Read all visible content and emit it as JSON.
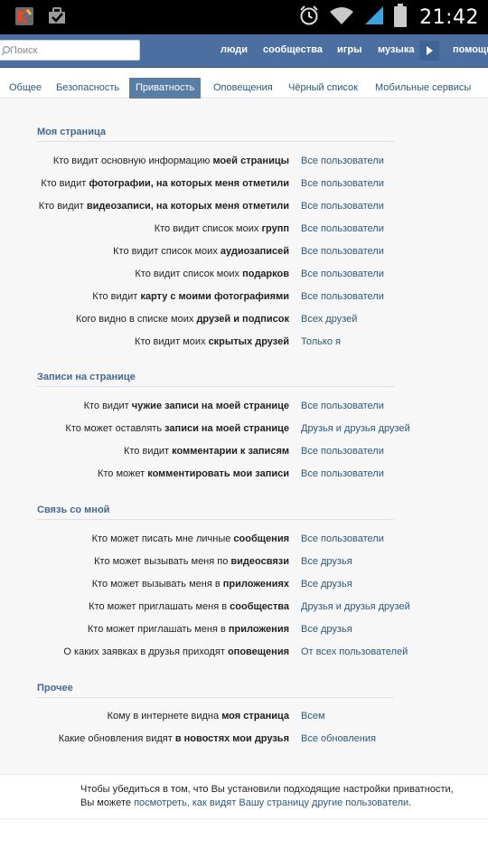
{
  "status_bar": {
    "time": "21:42",
    "icons": [
      "app-notification-icon",
      "briefcase-check-icon",
      "alarm-clock-icon",
      "wifi-icon",
      "signal-icon",
      "battery-icon"
    ]
  },
  "header": {
    "search": {
      "placeholder": "Поиск",
      "value": ""
    },
    "nav": [
      "люди",
      "сообщества",
      "игры",
      "музыка",
      "помощь"
    ],
    "more_icon": "play-arrow-icon",
    "colors": {
      "bar": "#4a6fa0",
      "link": "#2b587a",
      "section_title": "#45688e"
    }
  },
  "tabs": [
    {
      "label": "Общее",
      "active": false
    },
    {
      "label": "Безопасность",
      "active": false
    },
    {
      "label": "Приватность",
      "active": true
    },
    {
      "label": "Оповещения",
      "active": false
    },
    {
      "label": "Чёрный список",
      "active": false
    },
    {
      "label": "Мобильные сервисы",
      "active": false
    }
  ],
  "sections": [
    {
      "title": "Моя страница",
      "rows": [
        {
          "pre": "Кто видит основную информацию ",
          "bold": "моей страницы",
          "value": "Все пользователи"
        },
        {
          "pre": "Кто видит ",
          "bold": "фотографии, на которых меня отметили",
          "value": "Все пользователи"
        },
        {
          "pre": "Кто видит ",
          "bold": "видеозаписи, на которых меня отметили",
          "value": "Все пользователи"
        },
        {
          "pre": "Кто видит список моих ",
          "bold": "групп",
          "value": "Все пользователи"
        },
        {
          "pre": "Кто видит список моих ",
          "bold": "аудиозаписей",
          "value": "Все пользователи"
        },
        {
          "pre": "Кто видит список моих ",
          "bold": "подарков",
          "value": "Все пользователи"
        },
        {
          "pre": "Кто видит ",
          "bold": "карту с моими фотографиями",
          "value": "Все пользователи"
        },
        {
          "pre": "Кого видно в списке моих ",
          "bold": "друзей и подписок",
          "value": "Всех друзей"
        },
        {
          "pre": "Кто видит моих ",
          "bold": "скрытых друзей",
          "value": "Только я"
        }
      ]
    },
    {
      "title": "Записи на странице",
      "rows": [
        {
          "pre": "Кто видит ",
          "bold": "чужие записи на моей странице",
          "value": "Все пользователи"
        },
        {
          "pre": "Кто может оставлять ",
          "bold": "записи на моей странице",
          "value": "Друзья и друзья друзей"
        },
        {
          "pre": "Кто видит ",
          "bold": "комментарии к записям",
          "value": "Все пользователи"
        },
        {
          "pre": "Кто может ",
          "bold": "комментировать мои записи",
          "value": "Все пользователи"
        }
      ]
    },
    {
      "title": "Связь со мной",
      "rows": [
        {
          "pre": "Кто может писать мне личные ",
          "bold": "сообщения",
          "value": "Все пользователи"
        },
        {
          "pre": "Кто может вызывать меня по ",
          "bold": "видеосвязи",
          "value": "Все друзья"
        },
        {
          "pre": "Кто может вызывать меня в ",
          "bold": "приложениях",
          "value": "Все друзья"
        },
        {
          "pre": "Кто может приглашать меня в ",
          "bold": "сообщества",
          "value": "Друзья и друзья друзей"
        },
        {
          "pre": "Кто может приглашать меня в ",
          "bold": "приложения",
          "value": "Все друзья"
        },
        {
          "pre": "О каких заявках в друзья приходят ",
          "bold": "оповещения",
          "value": "От всех пользователей"
        }
      ]
    },
    {
      "title": "Прочее",
      "rows": [
        {
          "pre": "Кому в интернете видна ",
          "bold": "моя страница",
          "value": "Всем"
        },
        {
          "pre": "Какие обновления видят ",
          "bold": "в новостях мои друзья",
          "value": "Все обновления"
        }
      ]
    }
  ],
  "footer": {
    "line1": "Чтобы убедиться в том, что Вы установили подходящие настройки приватности,",
    "line2_pre": "Вы можете ",
    "line2_link": "посмотреть, как видят Вашу страницу другие пользователи",
    "line2_post": "."
  }
}
